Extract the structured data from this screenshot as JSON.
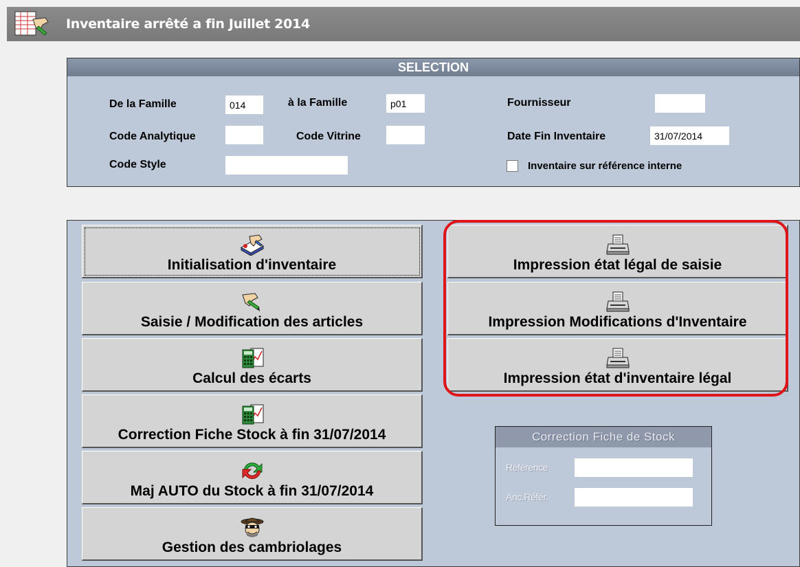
{
  "window": {
    "title": "Inventaire arrêté a fin Juillet 2014",
    "icon": "inventory-hand-icon"
  },
  "selection": {
    "heading": "SELECTION",
    "de_la_famille": {
      "label": "De la Famille",
      "value": "014"
    },
    "a_la_famille": {
      "label": "à la Famille",
      "value": "p01"
    },
    "fournisseur": {
      "label": "Fournisseur",
      "value": ""
    },
    "code_analytique": {
      "label": "Code Analytique",
      "value": ""
    },
    "code_vitrine": {
      "label": "Code Vitrine",
      "value": ""
    },
    "date_fin_inventaire": {
      "label": "Date Fin Inventaire",
      "value": "31/07/2014"
    },
    "code_style": {
      "label": "Code Style",
      "value": ""
    },
    "reference_interne": {
      "label": "Inventaire sur référence interne",
      "checked": false
    }
  },
  "actions": {
    "left": [
      {
        "label": "Initialisation d'inventaire",
        "icon": "notebook-pen-icon"
      },
      {
        "label": "Saisie / Modification des articles",
        "icon": "hand-pen-icon"
      },
      {
        "label": "Calcul des écarts",
        "icon": "calculator-chart-icon"
      },
      {
        "label": "Correction Fiche Stock à fin 31/07/2014",
        "icon": "calculator-chart-icon"
      },
      {
        "label": "Maj AUTO du Stock à fin 31/07/2014",
        "icon": "refresh-arrows-icon"
      },
      {
        "label": "Gestion des cambriolages",
        "icon": "burglar-icon"
      }
    ],
    "right": [
      {
        "label": "Impression état légal de saisie",
        "icon": "printer-icon"
      },
      {
        "label": "Impression Modifications d'Inventaire",
        "icon": "printer-icon"
      },
      {
        "label": "Impression état d'inventaire légal",
        "icon": "printer-icon"
      }
    ]
  },
  "correction": {
    "heading": "Correction Fiche de Stock",
    "reference_label": "Référence",
    "anc_refer_label": "Anc.Référ.",
    "reference_value": "",
    "anc_refer_value": ""
  },
  "colors": {
    "highlight_frame": "#e0151a",
    "panel_bg": "#bdc8d8",
    "title_bar": "#7f7f7f"
  }
}
